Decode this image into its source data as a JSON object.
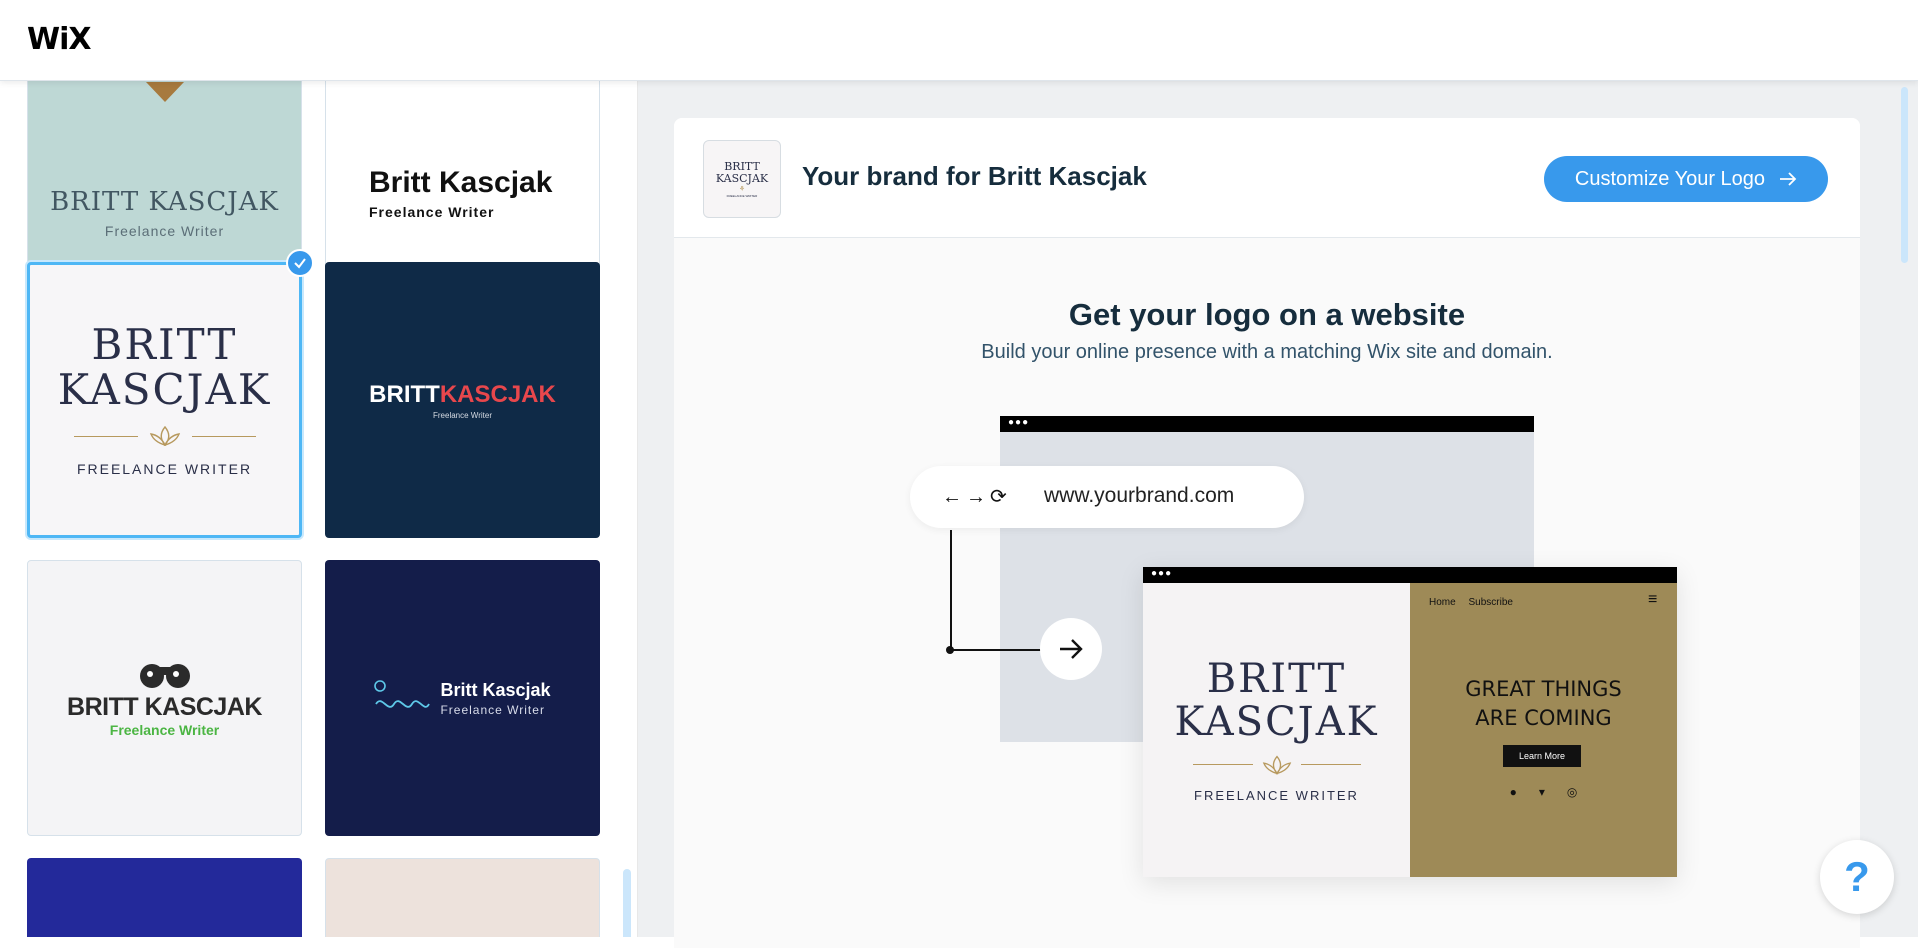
{
  "header": {
    "logo": "WiX"
  },
  "logos": [
    {
      "name": "BRITT KASCJAK",
      "tagline": "Freelance Writer"
    },
    {
      "name": "Britt Kascjak",
      "tagline": "Freelance Writer"
    },
    {
      "name_line1": "BRITT",
      "name_line2": "KASCJAK",
      "tagline": "FREELANCE WRITER"
    },
    {
      "name_part1": "BRITT",
      "name_part2": "KASCJAK",
      "tagline": "Freelance Writer"
    },
    {
      "name": "BRITT KASCJAK",
      "tagline": "Freelance Writer"
    },
    {
      "name": "Britt Kascjak",
      "tagline": "Freelance Writer"
    }
  ],
  "brand": {
    "title": "Your brand for Britt Kascjak",
    "thumb_line1": "BRITT",
    "thumb_line2": "KASCJAK",
    "thumb_tagline": "FREELANCE WRITER",
    "customize_label": "Customize Your Logo",
    "customize_icon": "arrow-right-icon"
  },
  "promo": {
    "title": "Get your logo on a website",
    "subtitle": "Build your online presence with a matching Wix site and domain."
  },
  "illustration": {
    "url": "www.yourbrand.com",
    "nav_glyphs": "←→⟳",
    "site_name_line1": "BRITT",
    "site_name_line2": "KASCJAK",
    "site_tagline": "FREELANCE WRITER",
    "nav_home": "Home",
    "nav_subscribe": "Subscribe",
    "headline_line1": "GREAT THINGS",
    "headline_line2": "ARE COMING",
    "button": "Learn More"
  },
  "help": {
    "label": "?"
  },
  "colors": {
    "accent": "#3899ec",
    "tile_teal": "#bed8d5",
    "tile_navy": "#0f2a47",
    "tile_midnight": "#141d4a",
    "tile_blue": "#23299a",
    "tile_beige": "#ede2dc",
    "red_accent": "#e8474c",
    "green_accent": "#4bb543",
    "gold": "#b08d57"
  }
}
